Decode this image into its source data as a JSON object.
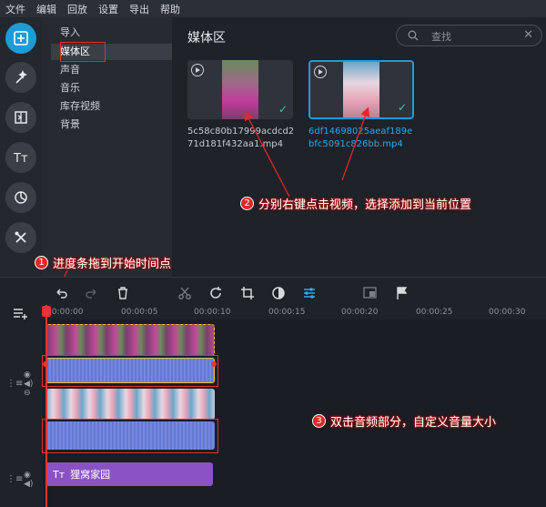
{
  "menu": [
    "文件",
    "编辑",
    "回放",
    "设置",
    "导出",
    "帮助"
  ],
  "categories": [
    "导入",
    "媒体区",
    "声音",
    "音乐",
    "库存视频",
    "背景"
  ],
  "media": {
    "title": "媒体区",
    "search_placeholder": "查找",
    "items": [
      {
        "name": "5c58c80b17999acdcd271d181f432aa1.mp4",
        "selected": false
      },
      {
        "name": "6df14698025aeaf189ebfc5091c826bb.mp4",
        "selected": true
      }
    ]
  },
  "annotations": {
    "a1": {
      "num": "1",
      "text": "进度条拖到开始时间点"
    },
    "a2": {
      "num": "2",
      "text": "分别右键点击视频，选择添加到当前位置"
    },
    "a3": {
      "num": "3",
      "text": "双击音频部分，自定义音量大小"
    }
  },
  "ruler": [
    "00:00:00",
    "00:00:05",
    "00:00:10",
    "00:00:15",
    "00:00:20",
    "00:00:25",
    "00:00:30"
  ],
  "title_clip": "狸窝家园",
  "colors": {
    "accent": "#1f9bd8",
    "annotation": "#e32727",
    "audio": "#8091e0",
    "title_clip": "#8b52c5"
  }
}
